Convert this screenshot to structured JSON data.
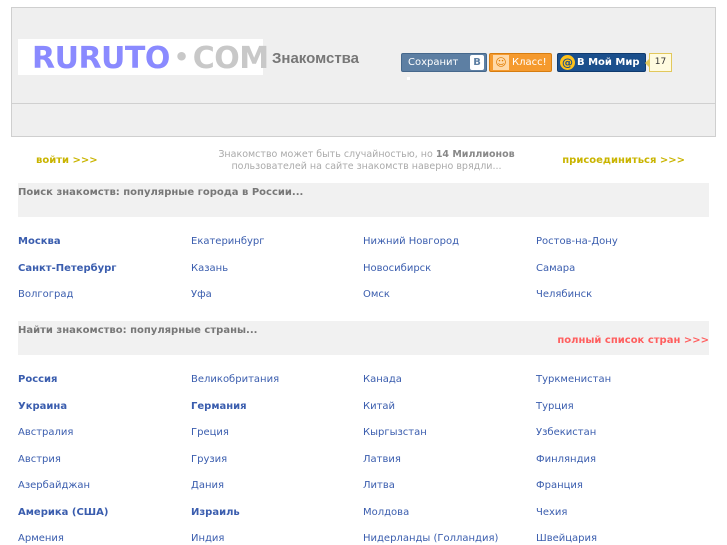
{
  "header": {
    "logo_main": "RURUTO",
    "logo_dot": "•",
    "logo_com": "COM",
    "tagline": "Знакомства",
    "share": {
      "label": "Сохранит",
      "vk_letter": "В"
    },
    "ok": {
      "icon": "☺",
      "label": "Класс!"
    },
    "mymir": {
      "icon": "@",
      "label": "В Мой Мир"
    },
    "counter": "17"
  },
  "intro": {
    "login": "войти >>>",
    "join": "присоединиться >>>",
    "promo_before": "Знакомство может быть случайностью, но ",
    "promo_bold": "14 Миллионов",
    "promo_after": " пользователей на сайте знакомств наверно врядли..."
  },
  "cities_section": {
    "title": "Поиск знакомств: популярные города в России...",
    "items": [
      {
        "name": "Москва",
        "bold": true
      },
      {
        "name": "Екатеринбург",
        "bold": false
      },
      {
        "name": "Нижний Новгород",
        "bold": false
      },
      {
        "name": "Ростов-на-Дону",
        "bold": false
      },
      {
        "name": "Санкт-Петербург",
        "bold": true
      },
      {
        "name": "Казань",
        "bold": false
      },
      {
        "name": "Новосибирск",
        "bold": false
      },
      {
        "name": "Самара",
        "bold": false
      },
      {
        "name": "Волгоград",
        "bold": false
      },
      {
        "name": "Уфа",
        "bold": false
      },
      {
        "name": "Омск",
        "bold": false
      },
      {
        "name": "Челябинск",
        "bold": false
      }
    ]
  },
  "countries_section": {
    "title": "Найти знакомство: популярные страны...",
    "full_list": "полный список стран >>>",
    "items": [
      {
        "name": "Россия",
        "bold": true
      },
      {
        "name": "Великобритания",
        "bold": false
      },
      {
        "name": "Канада",
        "bold": false
      },
      {
        "name": "Туркменистан",
        "bold": false
      },
      {
        "name": "Украина",
        "bold": true
      },
      {
        "name": "Германия",
        "bold": true
      },
      {
        "name": "Китай",
        "bold": false
      },
      {
        "name": "Турция",
        "bold": false
      },
      {
        "name": "Австралия",
        "bold": false
      },
      {
        "name": "Греция",
        "bold": false
      },
      {
        "name": "Кыргызстан",
        "bold": false
      },
      {
        "name": "Узбекистан",
        "bold": false
      },
      {
        "name": "Австрия",
        "bold": false
      },
      {
        "name": "Грузия",
        "bold": false
      },
      {
        "name": "Латвия",
        "bold": false
      },
      {
        "name": "Финляндия",
        "bold": false
      },
      {
        "name": "Азербайджан",
        "bold": false
      },
      {
        "name": "Дания",
        "bold": false
      },
      {
        "name": "Литва",
        "bold": false
      },
      {
        "name": "Франция",
        "bold": false
      },
      {
        "name": "Америка (США)",
        "bold": true
      },
      {
        "name": "Израиль",
        "bold": true
      },
      {
        "name": "Молдова",
        "bold": false
      },
      {
        "name": "Чехия",
        "bold": false
      },
      {
        "name": "Армения",
        "bold": false
      },
      {
        "name": "Индия",
        "bold": false
      },
      {
        "name": "Нидерланды (Голландия)",
        "bold": false
      },
      {
        "name": "Швейцария",
        "bold": false
      }
    ]
  }
}
